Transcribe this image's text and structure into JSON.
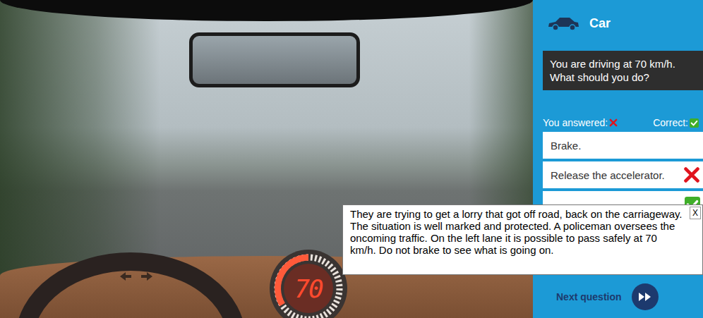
{
  "scene": {
    "speed": "70"
  },
  "panel": {
    "vehicle": "Car",
    "question": "You are driving at 70 km/h. What should you do?",
    "legend": {
      "answered_label": "You answered:",
      "correct_label": "Correct:"
    },
    "answers": [
      {
        "text": "Brake.",
        "chosen": false,
        "correct": false
      },
      {
        "text": "Release the accelerator.",
        "chosen": true,
        "correct": false
      },
      {
        "text": "",
        "chosen": false,
        "correct": true
      }
    ],
    "next": {
      "label": "Next question"
    }
  },
  "tooltip": {
    "text": "They are trying to get a lorry that got off road, back on the carriageway. The situation is well marked and protected. A policeman oversees the oncoming traffic. On the left lane it is possible to pass safely at 70 km/h. Do not brake to see what is going on.",
    "close": "X"
  }
}
